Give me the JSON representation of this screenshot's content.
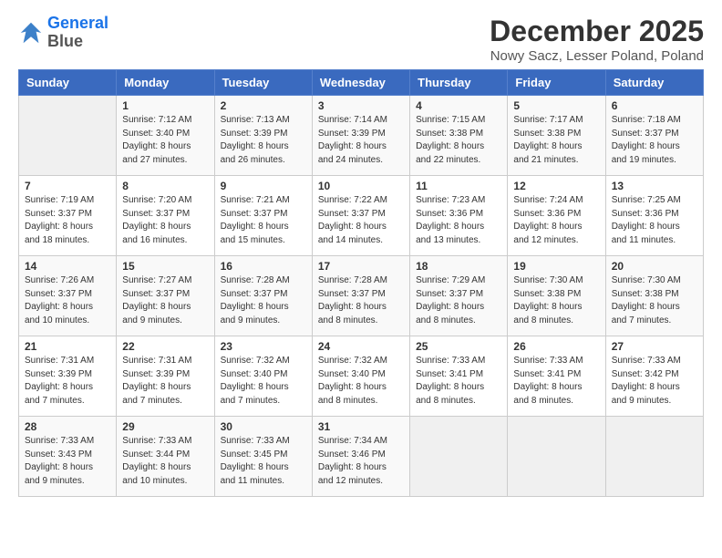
{
  "logo": {
    "line1": "General",
    "line2": "Blue"
  },
  "title": "December 2025",
  "subtitle": "Nowy Sacz, Lesser Poland, Poland",
  "days_header": [
    "Sunday",
    "Monday",
    "Tuesday",
    "Wednesday",
    "Thursday",
    "Friday",
    "Saturday"
  ],
  "weeks": [
    [
      {
        "num": "",
        "info": ""
      },
      {
        "num": "1",
        "info": "Sunrise: 7:12 AM\nSunset: 3:40 PM\nDaylight: 8 hours\nand 27 minutes."
      },
      {
        "num": "2",
        "info": "Sunrise: 7:13 AM\nSunset: 3:39 PM\nDaylight: 8 hours\nand 26 minutes."
      },
      {
        "num": "3",
        "info": "Sunrise: 7:14 AM\nSunset: 3:39 PM\nDaylight: 8 hours\nand 24 minutes."
      },
      {
        "num": "4",
        "info": "Sunrise: 7:15 AM\nSunset: 3:38 PM\nDaylight: 8 hours\nand 22 minutes."
      },
      {
        "num": "5",
        "info": "Sunrise: 7:17 AM\nSunset: 3:38 PM\nDaylight: 8 hours\nand 21 minutes."
      },
      {
        "num": "6",
        "info": "Sunrise: 7:18 AM\nSunset: 3:37 PM\nDaylight: 8 hours\nand 19 minutes."
      }
    ],
    [
      {
        "num": "7",
        "info": "Sunrise: 7:19 AM\nSunset: 3:37 PM\nDaylight: 8 hours\nand 18 minutes."
      },
      {
        "num": "8",
        "info": "Sunrise: 7:20 AM\nSunset: 3:37 PM\nDaylight: 8 hours\nand 16 minutes."
      },
      {
        "num": "9",
        "info": "Sunrise: 7:21 AM\nSunset: 3:37 PM\nDaylight: 8 hours\nand 15 minutes."
      },
      {
        "num": "10",
        "info": "Sunrise: 7:22 AM\nSunset: 3:37 PM\nDaylight: 8 hours\nand 14 minutes."
      },
      {
        "num": "11",
        "info": "Sunrise: 7:23 AM\nSunset: 3:36 PM\nDaylight: 8 hours\nand 13 minutes."
      },
      {
        "num": "12",
        "info": "Sunrise: 7:24 AM\nSunset: 3:36 PM\nDaylight: 8 hours\nand 12 minutes."
      },
      {
        "num": "13",
        "info": "Sunrise: 7:25 AM\nSunset: 3:36 PM\nDaylight: 8 hours\nand 11 minutes."
      }
    ],
    [
      {
        "num": "14",
        "info": "Sunrise: 7:26 AM\nSunset: 3:37 PM\nDaylight: 8 hours\nand 10 minutes."
      },
      {
        "num": "15",
        "info": "Sunrise: 7:27 AM\nSunset: 3:37 PM\nDaylight: 8 hours\nand 9 minutes."
      },
      {
        "num": "16",
        "info": "Sunrise: 7:28 AM\nSunset: 3:37 PM\nDaylight: 8 hours\nand 9 minutes."
      },
      {
        "num": "17",
        "info": "Sunrise: 7:28 AM\nSunset: 3:37 PM\nDaylight: 8 hours\nand 8 minutes."
      },
      {
        "num": "18",
        "info": "Sunrise: 7:29 AM\nSunset: 3:37 PM\nDaylight: 8 hours\nand 8 minutes."
      },
      {
        "num": "19",
        "info": "Sunrise: 7:30 AM\nSunset: 3:38 PM\nDaylight: 8 hours\nand 8 minutes."
      },
      {
        "num": "20",
        "info": "Sunrise: 7:30 AM\nSunset: 3:38 PM\nDaylight: 8 hours\nand 7 minutes."
      }
    ],
    [
      {
        "num": "21",
        "info": "Sunrise: 7:31 AM\nSunset: 3:39 PM\nDaylight: 8 hours\nand 7 minutes."
      },
      {
        "num": "22",
        "info": "Sunrise: 7:31 AM\nSunset: 3:39 PM\nDaylight: 8 hours\nand 7 minutes."
      },
      {
        "num": "23",
        "info": "Sunrise: 7:32 AM\nSunset: 3:40 PM\nDaylight: 8 hours\nand 7 minutes."
      },
      {
        "num": "24",
        "info": "Sunrise: 7:32 AM\nSunset: 3:40 PM\nDaylight: 8 hours\nand 8 minutes."
      },
      {
        "num": "25",
        "info": "Sunrise: 7:33 AM\nSunset: 3:41 PM\nDaylight: 8 hours\nand 8 minutes."
      },
      {
        "num": "26",
        "info": "Sunrise: 7:33 AM\nSunset: 3:41 PM\nDaylight: 8 hours\nand 8 minutes."
      },
      {
        "num": "27",
        "info": "Sunrise: 7:33 AM\nSunset: 3:42 PM\nDaylight: 8 hours\nand 9 minutes."
      }
    ],
    [
      {
        "num": "28",
        "info": "Sunrise: 7:33 AM\nSunset: 3:43 PM\nDaylight: 8 hours\nand 9 minutes."
      },
      {
        "num": "29",
        "info": "Sunrise: 7:33 AM\nSunset: 3:44 PM\nDaylight: 8 hours\nand 10 minutes."
      },
      {
        "num": "30",
        "info": "Sunrise: 7:33 AM\nSunset: 3:45 PM\nDaylight: 8 hours\nand 11 minutes."
      },
      {
        "num": "31",
        "info": "Sunrise: 7:34 AM\nSunset: 3:46 PM\nDaylight: 8 hours\nand 12 minutes."
      },
      {
        "num": "",
        "info": ""
      },
      {
        "num": "",
        "info": ""
      },
      {
        "num": "",
        "info": ""
      }
    ]
  ]
}
